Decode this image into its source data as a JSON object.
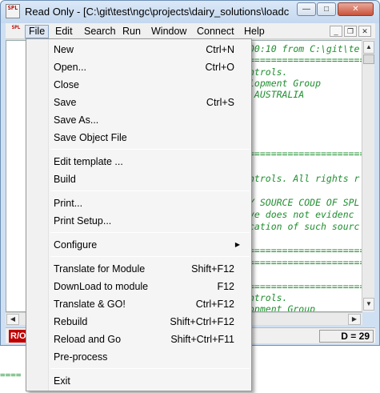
{
  "window": {
    "title": "Read Only - [C:\\git\\test\\ngc\\projects\\dairy_solutions\\loadcell",
    "app_icon_text": "SPL",
    "minimize_glyph": "—",
    "maximize_glyph": "□",
    "close_glyph": "✕"
  },
  "menubar": {
    "items": [
      "File",
      "Edit",
      "Search",
      "Run",
      "Window",
      "Connect",
      "Help"
    ],
    "active": "File",
    "mdi_minimize": "_",
    "mdi_restore": "❐",
    "mdi_close": "✕"
  },
  "editor": {
    "lines": [
      "00:10 from C:\\git\\te",
      "======================",
      "ntrols.",
      "lopment Group",
      " AUSTRALIA",
      "======================",
      "ntrols. All rights r",
      "Y SOURCE CODE OF SPL",
      "ve does not evidenc",
      "cation of such sourc",
      "======================",
      "======================",
      "======================",
      "ntrols.",
      "opment Group"
    ]
  },
  "status": {
    "left": "R/O",
    "right": "D = 29"
  },
  "outside": {
    "text": "===="
  },
  "file_menu": {
    "items": [
      {
        "label": "New",
        "shortcut": "Ctrl+N"
      },
      {
        "label": "Open...",
        "shortcut": "Ctrl+O"
      },
      {
        "label": "Close",
        "shortcut": ""
      },
      {
        "label": "Save",
        "shortcut": "Ctrl+S"
      },
      {
        "label": "Save As...",
        "shortcut": ""
      },
      {
        "label": "Save Object File",
        "shortcut": ""
      },
      {
        "label": "Edit template ...",
        "shortcut": ""
      },
      {
        "label": "Build",
        "shortcut": ""
      },
      {
        "label": "Print...",
        "shortcut": ""
      },
      {
        "label": "Print Setup...",
        "shortcut": ""
      },
      {
        "label": "Configure",
        "shortcut": "",
        "submenu": "▶"
      },
      {
        "label": "Translate for Module",
        "shortcut": "Shift+F12"
      },
      {
        "label": "DownLoad to module",
        "shortcut": "F12"
      },
      {
        "label": "Translate & GO!",
        "shortcut": "Ctrl+F12"
      },
      {
        "label": "Rebuild",
        "shortcut": "Shift+Ctrl+F12"
      },
      {
        "label": "Reload and Go",
        "shortcut": "Shift+Ctrl+F11"
      },
      {
        "label": "Pre-process",
        "shortcut": ""
      },
      {
        "label": "Exit",
        "shortcut": ""
      }
    ]
  }
}
